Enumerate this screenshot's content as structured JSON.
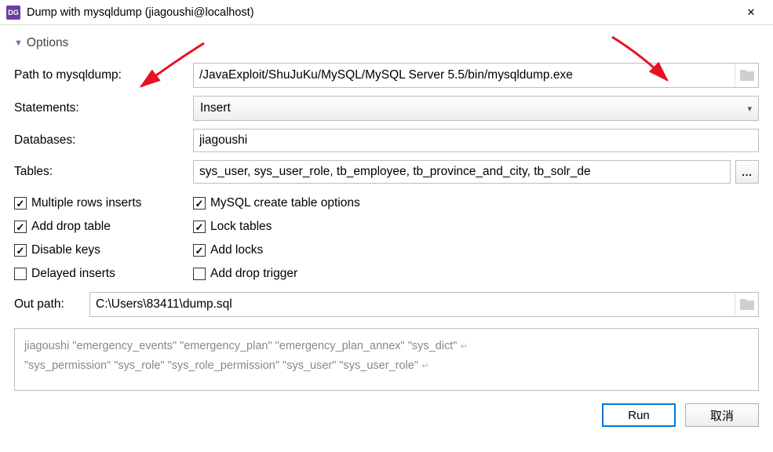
{
  "titlebar": {
    "title": "Dump with mysqldump (jiagoushi@localhost)"
  },
  "section": {
    "title": "Options"
  },
  "labels": {
    "path": "Path to mysqldump:",
    "statements": "Statements:",
    "databases": "Databases:",
    "tables": "Tables:",
    "out_path": "Out path:"
  },
  "fields": {
    "path": "/JavaExploit/ShuJuKu/MySQL/MySQL Server 5.5/bin/mysqldump.exe",
    "statements": "Insert",
    "databases": "jiagoushi",
    "tables": "sys_user, sys_user_role, tb_employee, tb_province_and_city, tb_solr_de",
    "out_path": "C:\\Users\\83411\\dump.sql",
    "ellipsis": "..."
  },
  "checks": {
    "left": [
      {
        "label": "Multiple rows inserts",
        "checked": true
      },
      {
        "label": "Add drop table",
        "checked": true
      },
      {
        "label": "Disable keys",
        "checked": true
      },
      {
        "label": "Delayed inserts",
        "checked": false
      }
    ],
    "right": [
      {
        "label": "MySQL create table options",
        "checked": true
      },
      {
        "label": "Lock tables",
        "checked": true
      },
      {
        "label": "Add locks",
        "checked": true
      },
      {
        "label": "Add drop trigger",
        "checked": false
      }
    ]
  },
  "command": {
    "line1": "jiagoushi \"emergency_events\" \"emergency_plan\" \"emergency_plan_annex\" \"sys_dict\"",
    "line2": "\"sys_permission\" \"sys_role\" \"sys_role_permission\" \"sys_user\" \"sys_user_role\""
  },
  "buttons": {
    "run": "Run",
    "cancel": "取消"
  }
}
